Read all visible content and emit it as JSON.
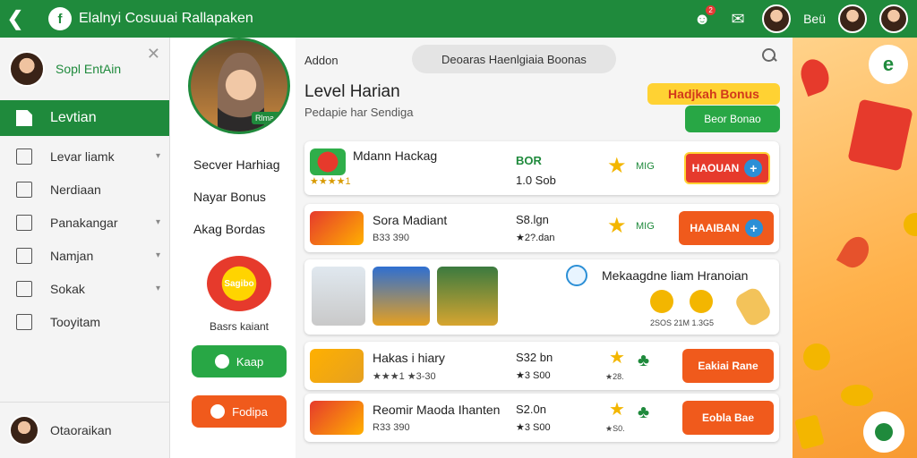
{
  "header": {
    "title": "Elalnyi Cosuuai Rallapaken",
    "logo_glyph": "f",
    "user_name": "Beü",
    "notif_count": "2"
  },
  "sidebar": {
    "profile_name": "Sopl EntAin",
    "active_item": "Levtian",
    "items": [
      {
        "label": "Levar liamk",
        "icon": "gift-icon",
        "has_chevron": true
      },
      {
        "label": "Nerdiaan",
        "icon": "home-icon",
        "has_chevron": false
      },
      {
        "label": "Panakangar",
        "icon": "bookmark-icon",
        "has_chevron": true
      },
      {
        "label": "Namjan",
        "icon": "square-icon",
        "has_chevron": true
      },
      {
        "label": "Sokak",
        "icon": "puzzle-icon",
        "has_chevron": true
      },
      {
        "label": "Tooyitam",
        "icon": "upload-icon",
        "has_chevron": false
      }
    ],
    "footer_name": "Otaoraikan"
  },
  "mid": {
    "photo_badge": "Rlmad",
    "links": [
      "Secver Harhiag",
      "Nayar Bonus",
      "Akag Bordas"
    ],
    "logo_text": "Sagibo",
    "caption": "Basrs kaiant",
    "btn_green": "Kaap",
    "btn_orange": "Fodipa"
  },
  "main": {
    "head_label": "Addon",
    "search_text": "Deoaras Haenlgiaia Boonas",
    "level_title": "Level Harian",
    "level_sub": "Pedapie har Sendiga",
    "bonus_pill": "Hadjkah Bonus",
    "green_pill": "Beor Bonao",
    "cards": [
      {
        "title": "Mdann Hackag",
        "meta": "★★★★1",
        "price_top": "BOR",
        "price": "1.0 Sob",
        "tag": "MIG",
        "btn": "HAOUAN"
      },
      {
        "title": "Sora Madiant",
        "meta": "B33 390",
        "price_top": "S8.lgn",
        "price": "★2?.dan",
        "tag": "MIG",
        "btn": "HAAIBAN"
      },
      {
        "title": "Mekaagdne liam Hranoian",
        "meta": "2SOS 21M 1.3G5",
        "price_top": "",
        "price": "",
        "tag": "",
        "btn": ""
      },
      {
        "title": "Hakas i hiary",
        "meta": "★★★1 ★3-30",
        "price_top": "S32 bn",
        "price": "★3 S00",
        "tag": "★28.",
        "btn": "Eakiai Rane"
      },
      {
        "title": "Reomir Maoda Ihanten",
        "meta": "R33 390",
        "price_top": "S2.0n",
        "price": "★3 S00",
        "tag": "★S0.",
        "btn": "Eobla Bae"
      }
    ]
  },
  "colors": {
    "brand_green": "#1f8a3c",
    "accent_orange": "#f05a1c",
    "star_yellow": "#f3b600",
    "panel_orange": "#ffb14a"
  }
}
